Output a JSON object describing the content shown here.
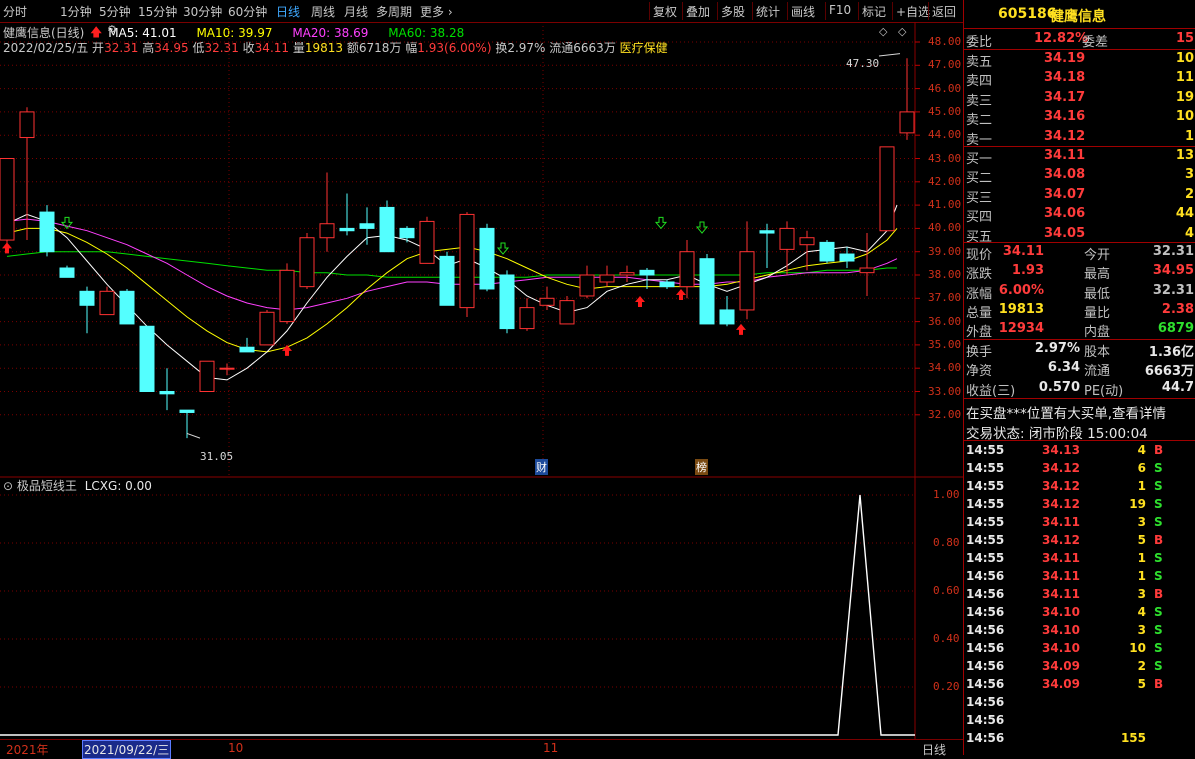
{
  "toolbar": {
    "left_tabs": [
      "分时",
      "1分钟",
      "5分钟",
      "15分钟",
      "30分钟",
      "60分钟",
      "日线",
      "周线",
      "月线",
      "多周期",
      "更多 ›"
    ],
    "active_tab": "日线",
    "right_tabs": [
      "复权",
      "叠加",
      "多股",
      "统计",
      "画线",
      "F10",
      "标记",
      "+自选",
      "返回"
    ]
  },
  "chart": {
    "title": "健鹰信息(日线)",
    "ma5": "MA5: 41.01",
    "ma10": "MA10: 39.97",
    "ma20": "MA20: 38.69",
    "ma60": "MA60: 38.28",
    "ohlc_line": {
      "date": "2022/02/25/五",
      "open_label": "开",
      "open": "32.31",
      "high_label": "高",
      "high": "34.95",
      "low_label": "低",
      "low": "32.31",
      "close_label": "收",
      "close": "34.11",
      "vol_label": "量",
      "vol": "19813",
      "amt_label": "额",
      "amt": "6718万",
      "chg_label": "幅",
      "chg": "1.93(6.00%)",
      "turnover": "换2.97%",
      "float": "流通6663万",
      "sector": "医疗保健"
    },
    "y_ticks": [
      "48.00",
      "47.00",
      "46.00",
      "45.00",
      "44.00",
      "43.00",
      "42.00",
      "41.00",
      "40.00",
      "39.00",
      "38.00",
      "37.00",
      "36.00",
      "35.00",
      "34.00",
      "33.00",
      "32.00"
    ],
    "high_marker": "47.30",
    "low_marker": "31.05",
    "event_labels": [
      "财",
      "榜"
    ],
    "indicator_title": "极品短线王",
    "indicator_value": "LCXG: 0.00",
    "sub_ticks": [
      "1.00",
      "0.80",
      "0.60",
      "0.40",
      "0.20"
    ],
    "x_labels": [
      "2021年",
      "2021/09/22/三",
      "10",
      "11"
    ],
    "period_label": "日线",
    "colors": {
      "up": "#ff3232",
      "down": "#54ffff",
      "ma5": "#ffffff",
      "ma10": "#ffff00",
      "ma20": "#ff40ff",
      "ma60": "#00e000",
      "grid": "#7a0000"
    }
  },
  "quote": {
    "code": "605186",
    "name": "健鹰信息",
    "weibi_label": "委比",
    "weibi": "12.82%",
    "weicha_label": "委差",
    "weicha": "15",
    "asks": [
      {
        "label": "卖五",
        "price": "34.19",
        "vol": "10"
      },
      {
        "label": "卖四",
        "price": "34.18",
        "vol": "11"
      },
      {
        "label": "卖三",
        "price": "34.17",
        "vol": "19"
      },
      {
        "label": "卖二",
        "price": "34.16",
        "vol": "10"
      },
      {
        "label": "卖一",
        "price": "34.12",
        "vol": "1"
      }
    ],
    "bids": [
      {
        "label": "买一",
        "price": "34.11",
        "vol": "13"
      },
      {
        "label": "买二",
        "price": "34.08",
        "vol": "3"
      },
      {
        "label": "买三",
        "price": "34.07",
        "vol": "2"
      },
      {
        "label": "买四",
        "price": "34.06",
        "vol": "44"
      },
      {
        "label": "买五",
        "price": "34.05",
        "vol": "4"
      }
    ],
    "stats": [
      {
        "l1": "现价",
        "v1": "34.11",
        "c1": "red",
        "l2": "今开",
        "v2": "32.31",
        "c2": "gray"
      },
      {
        "l1": "涨跌",
        "v1": "1.93",
        "c1": "red",
        "l2": "最高",
        "v2": "34.95",
        "c2": "red"
      },
      {
        "l1": "涨幅",
        "v1": "6.00%",
        "c1": "red",
        "l2": "最低",
        "v2": "32.31",
        "c2": "gray"
      },
      {
        "l1": "总量",
        "v1": "19813",
        "c1": "yellow",
        "l2": "量比",
        "v2": "2.38",
        "c2": "red"
      },
      {
        "l1": "外盘",
        "v1": "12934",
        "c1": "red",
        "l2": "内盘",
        "v2": "6879",
        "c2": "green"
      }
    ],
    "stats2": [
      {
        "l1": "换手",
        "v1": "2.97%",
        "l2": "股本",
        "v2": "1.36亿"
      },
      {
        "l1": "净资",
        "v1": "6.34",
        "l2": "流通",
        "v2": "6663万"
      },
      {
        "l1": "收益(三)",
        "v1": "0.570",
        "l2": "PE(动)",
        "v2": "44.7"
      }
    ],
    "notice": "在买盘***位置有大买单,查看详情",
    "status": "交易状态: 闭市阶段 15:00:04",
    "ticks": [
      {
        "t": "14:55",
        "p": "34.13",
        "v": "4",
        "s": "B"
      },
      {
        "t": "14:55",
        "p": "34.12",
        "v": "6",
        "s": "S"
      },
      {
        "t": "14:55",
        "p": "34.12",
        "v": "1",
        "s": "S"
      },
      {
        "t": "14:55",
        "p": "34.12",
        "v": "19",
        "s": "S"
      },
      {
        "t": "14:55",
        "p": "34.11",
        "v": "3",
        "s": "S"
      },
      {
        "t": "14:55",
        "p": "34.12",
        "v": "5",
        "s": "B"
      },
      {
        "t": "14:55",
        "p": "34.11",
        "v": "1",
        "s": "S"
      },
      {
        "t": "14:56",
        "p": "34.11",
        "v": "1",
        "s": "S"
      },
      {
        "t": "14:56",
        "p": "34.11",
        "v": "3",
        "s": "B"
      },
      {
        "t": "14:56",
        "p": "34.10",
        "v": "4",
        "s": "S"
      },
      {
        "t": "14:56",
        "p": "34.10",
        "v": "3",
        "s": "S"
      },
      {
        "t": "14:56",
        "p": "34.10",
        "v": "10",
        "s": "S"
      },
      {
        "t": "14:56",
        "p": "34.09",
        "v": "2",
        "s": "S"
      },
      {
        "t": "14:56",
        "p": "34.09",
        "v": "5",
        "s": "B"
      },
      {
        "t": "14:56",
        "p": "",
        "v": "",
        "s": ""
      },
      {
        "t": "14:56",
        "p": "",
        "v": "",
        "s": ""
      },
      {
        "t": "14:56",
        "p": "",
        "v": "155",
        "s": ""
      }
    ]
  }
}
